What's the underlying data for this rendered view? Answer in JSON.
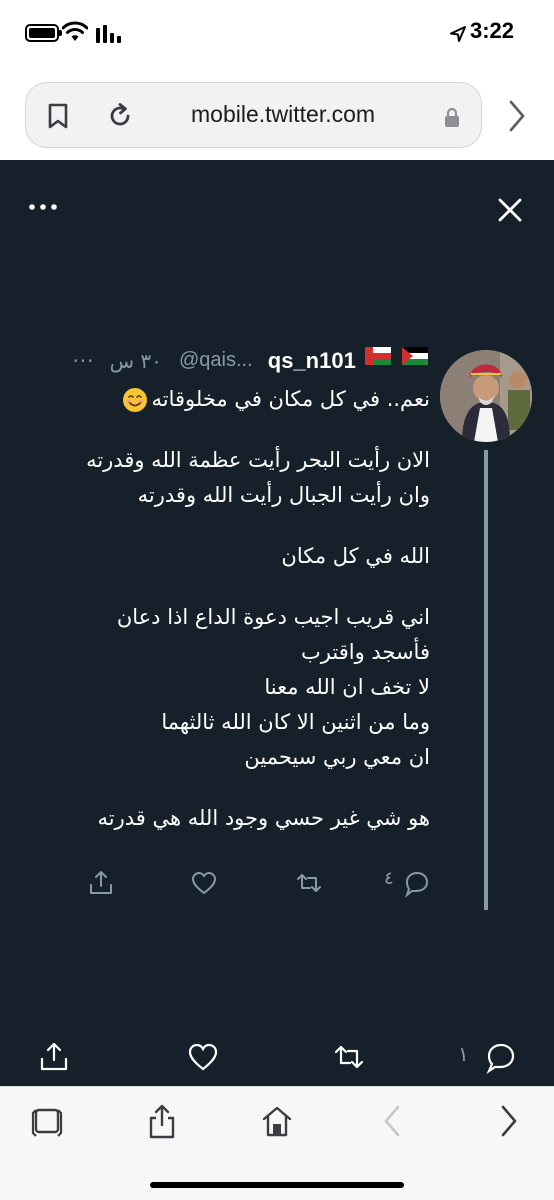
{
  "status_bar": {
    "time": "3:22",
    "icons": [
      "battery-icon",
      "wifi-icon",
      "signal-icon",
      "location-arrow-icon"
    ]
  },
  "browser": {
    "url": "mobile.twitter.com",
    "icons": [
      "bookmark-icon",
      "reload-icon",
      "lock-icon",
      "forward-chevron-icon"
    ]
  },
  "header": {
    "icons": [
      "more-menu-icon",
      "close-icon"
    ]
  },
  "tweet": {
    "display_name": "qs_n101",
    "flags": [
      "palestine-flag-emoji",
      "oman-flag-emoji"
    ],
    "handle": "@qais...",
    "timestamp": "٣٠ س",
    "more": "···",
    "lines": [
      "نعم.. في كل مكان في مخلوقاته",
      "",
      "الان رأيت البحر رأيت عظمة الله وقدرته",
      "وان رأيت الجبال رأيت الله وقدرته",
      "",
      "الله في كل مكان",
      "",
      "اني قريب اجيب دعوة الداع اذا دعان",
      "فأسجد واقترب",
      "لا تخف ان الله معنا",
      "وما من اثنين الا كان الله ثالثهما",
      "ان معي ربي سيحمين",
      "",
      "هو شي غير حسي وجود الله هي قدرته"
    ],
    "emoji": "smiling-face-emoji",
    "reply_count": "٤",
    "action_icons": [
      "reply-icon",
      "retweet-icon",
      "like-icon",
      "share-icon"
    ]
  },
  "bottom_bar": {
    "reply_count": "١",
    "icons": [
      "reply-icon",
      "retweet-icon",
      "like-icon",
      "share-icon"
    ]
  },
  "safari_toolbar": {
    "icons": [
      "tabs-icon",
      "share-icon",
      "home-icon",
      "back-icon",
      "forward-icon"
    ]
  },
  "colors": {
    "background": "#15202b",
    "secondary_text": "#8899a6",
    "primary_text": "#ffffff"
  }
}
